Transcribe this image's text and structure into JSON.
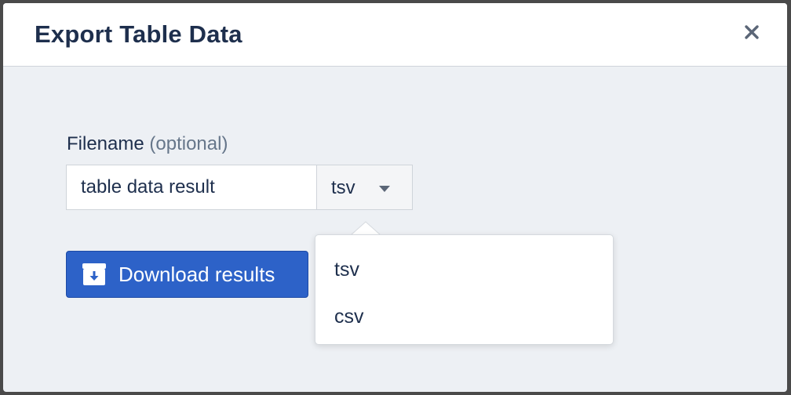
{
  "modal": {
    "title": "Export Table Data",
    "close_icon": "close-icon"
  },
  "form": {
    "filename_label": "Filename",
    "filename_optional": "(optional)",
    "filename_value": "table data result",
    "format_selected": "tsv",
    "format_options": [
      "tsv",
      "csv"
    ]
  },
  "actions": {
    "download_label": "Download results",
    "download_icon": "archive-download-icon"
  },
  "colors": {
    "title_text": "#1e2f4d",
    "primary_button": "#2d62c8",
    "modal_body": "#edf0f4"
  }
}
